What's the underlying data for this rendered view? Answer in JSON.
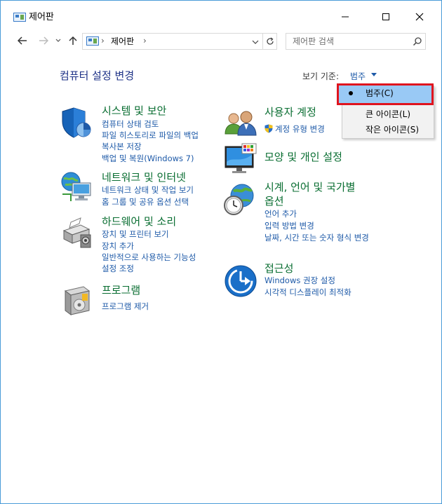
{
  "window": {
    "title": "제어판"
  },
  "nav": {
    "breadcrumb": "제어판",
    "search_placeholder": "제어판 검색"
  },
  "header": {
    "title": "컴퓨터 설정 변경",
    "view_by_label": "보기 기준:",
    "view_by_value": "범주"
  },
  "view_menu": {
    "items": [
      "범주(C)",
      "큰 아이콘(L)",
      "작은 아이콘(S)"
    ],
    "selected_index": 0
  },
  "categories": {
    "system": {
      "title": "시스템 및 보안",
      "links": [
        "컴퓨터 상태 검토",
        "파일 히스토리로 파일의 백업",
        "복사본 저장",
        "백업 및 복원(Windows 7)"
      ]
    },
    "network": {
      "title": "네트워크 및 인터넷",
      "links": [
        "네트워크 상태 및 작업 보기",
        "홈 그룹 및 공유 옵션 선택"
      ]
    },
    "hardware": {
      "title": "하드웨어 및 소리",
      "links": [
        "장치 및 프린터 보기",
        "장치 추가",
        "일반적으로 사용하는 기능성",
        "설정 조정"
      ]
    },
    "programs": {
      "title": "프로그램",
      "links": [
        "프로그램 제거"
      ]
    },
    "accounts": {
      "title": "사용자 계정",
      "links": [
        "계정 유형 변경"
      ]
    },
    "appearance": {
      "title": "모양 및 개인 설정",
      "links": []
    },
    "clock": {
      "title_line1": "시계, 언어 및 국가별",
      "title_line2": "옵션",
      "links": [
        "언어 추가",
        "입력 방법 변경",
        "날짜, 시간 또는 숫자 형식 변경"
      ]
    },
    "access": {
      "title": "접근성",
      "links": [
        "Windows 권장 설정",
        "시각적 디스플레이 최적화"
      ]
    }
  },
  "colors": {
    "category_title": "#0a6e32",
    "link": "#1e5aa8",
    "page_title": "#1e3287",
    "menu_highlight": "#99c9f5",
    "annotation_box": "#e0141e"
  }
}
